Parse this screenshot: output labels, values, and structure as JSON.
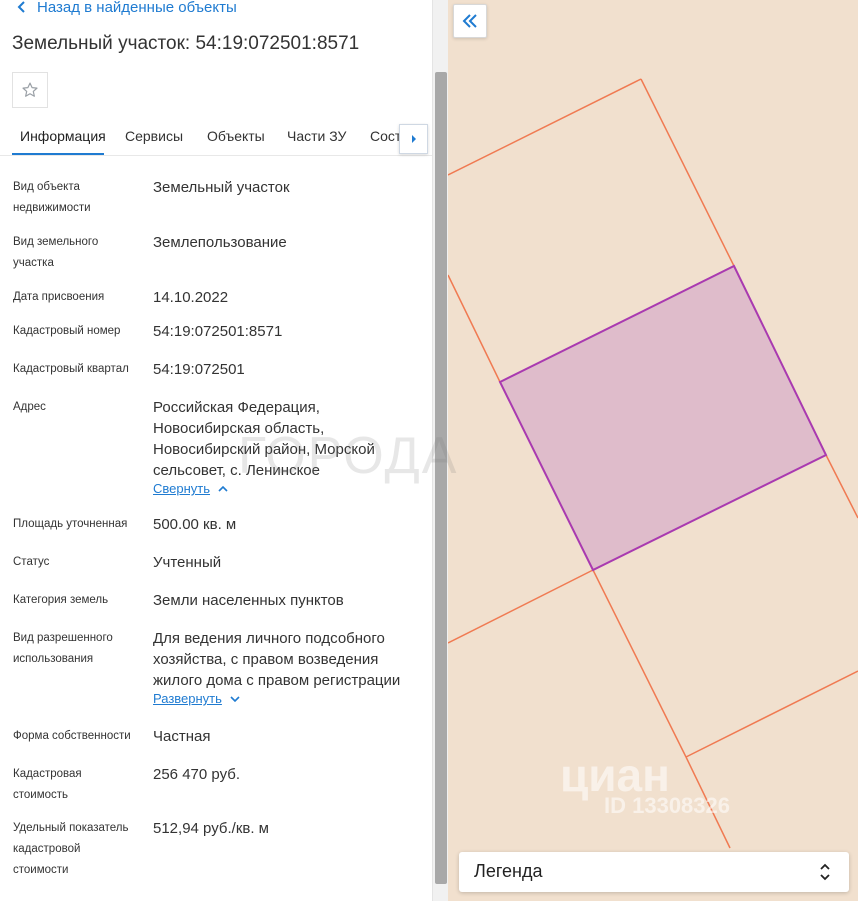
{
  "nav": {
    "back_label": "Назад в найденные объекты"
  },
  "object": {
    "title": "Земельный участок: 54:19:072501:8571"
  },
  "tabs": [
    {
      "label": "Информация",
      "active": true
    },
    {
      "label": "Сервисы"
    },
    {
      "label": "Объекты"
    },
    {
      "label": "Части ЗУ"
    },
    {
      "label": "Состав"
    }
  ],
  "fields": [
    {
      "label": "Вид объекта недвижимости",
      "value": "Земельный участок"
    },
    {
      "label": "Вид земельного участка",
      "value": "Землепользование"
    },
    {
      "label": "Дата присвоения",
      "value": "14.10.2022"
    },
    {
      "label": "Кадастровый номер",
      "value": "54:19:072501:8571"
    },
    {
      "label": "Кадастровый квартал",
      "value": "54:19:072501"
    },
    {
      "label": "Адрес",
      "value": "Российская Федерация, Новосибирская область, Новосибирский район, Морской сельсовет, с. Ленинское",
      "toggle": "Свернуть"
    },
    {
      "label": "Площадь уточненная",
      "value": "500.00 кв. м"
    },
    {
      "label": "Статус",
      "value": "Учтенный"
    },
    {
      "label": "Категория земель",
      "value": "Земли населенных пунктов"
    },
    {
      "label": "Вид разрешенного использования",
      "value": "Для ведения личного подсобного хозяйства, с правом возведения жилого дома с правом регистрации",
      "toggle": "Развернуть"
    },
    {
      "label": "Форма собственности",
      "value": "Частная"
    },
    {
      "label": "Кадастровая стоимость",
      "value": "256 470 руб."
    },
    {
      "label": "Удельный показатель кадастровой стоимости",
      "value": "512,94 руб./кв. м"
    }
  ],
  "map": {
    "legend_label": "Легенда",
    "colors": {
      "background": "#f1e0ce",
      "boundary": "#f07a52",
      "selected_fill": "#dfbccb",
      "selected_stroke": "#a93ab0"
    }
  },
  "watermarks": {
    "city": "ГОРОДА",
    "brand": "циан",
    "id": "ID 13308326"
  },
  "icons": {
    "back": "chevron-left-icon",
    "favorite": "star-icon",
    "tabs_next": "chevron-right-icon",
    "collapse": "double-chevron-left-icon",
    "legend": "chevron-up-down-icon",
    "toggle_up": "chevron-up-icon",
    "toggle_down": "chevron-down-icon"
  }
}
